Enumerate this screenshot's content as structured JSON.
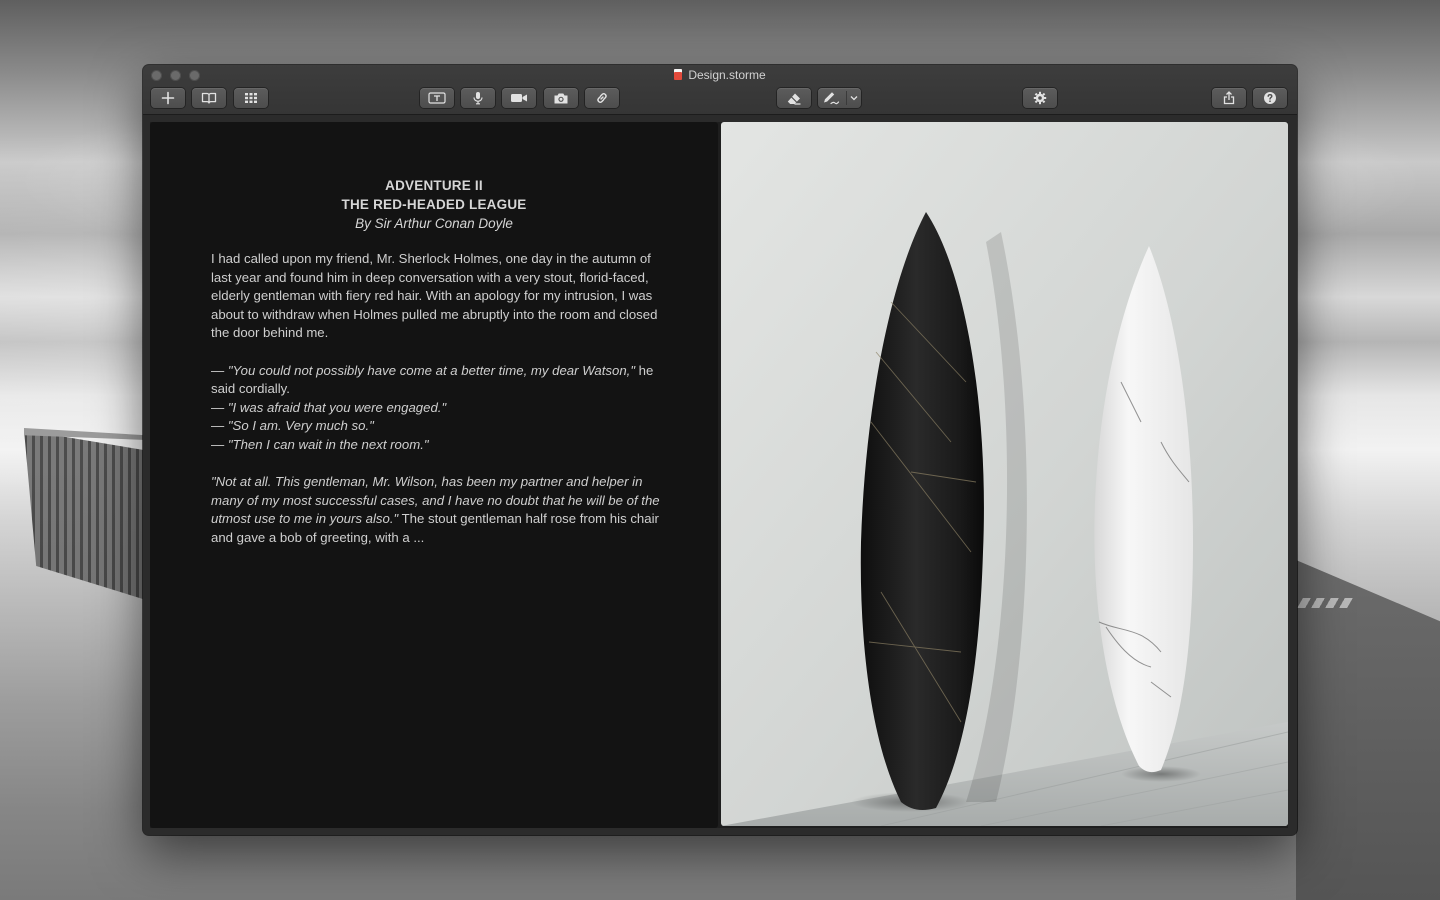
{
  "window": {
    "title": "Design.storme"
  },
  "toolbar": {
    "left": [
      {
        "name": "add-icon"
      },
      {
        "name": "book-icon"
      },
      {
        "name": "grid-icon"
      }
    ],
    "center": [
      {
        "name": "text-box-icon"
      },
      {
        "name": "microphone-icon"
      },
      {
        "name": "video-camera-icon"
      },
      {
        "name": "camera-icon"
      },
      {
        "name": "link-icon"
      }
    ],
    "tools": [
      {
        "name": "eraser-icon"
      },
      {
        "name": "pen-tool-icon"
      },
      {
        "name": "chevron-down-icon"
      }
    ],
    "settings": {
      "name": "gear-icon"
    },
    "right": [
      {
        "name": "share-icon"
      },
      {
        "name": "help-icon"
      }
    ]
  },
  "document": {
    "chapter": "ADVENTURE II",
    "story_title": "THE RED-HEADED LEAGUE",
    "byline": "By Sir Arthur Conan Doyle",
    "paragraph1": "I had called upon my friend, Mr. Sherlock Holmes, one day in the autumn of last year and found him in deep conversation with a very stout, florid-faced, elderly gentleman with fiery red hair. With an apology for my intrusion, I was about to withdraw when Holmes pulled me abruptly into the room and closed the door behind me.",
    "dialogue": [
      {
        "dash": "— ",
        "quote": "\"You could not possibly have come at a better time, my dear Watson,\"",
        "after": " he said cordially."
      },
      {
        "dash": "— ",
        "quote": "\"I was afraid that you were engaged.\"",
        "after": ""
      },
      {
        "dash": "— ",
        "quote": "\"So I am. Very much so.\"",
        "after": ""
      },
      {
        "dash": "— ",
        "quote": "\"Then I can wait in the next room.\"",
        "after": ""
      }
    ],
    "paragraph3_italic": "\"Not at all. This gentleman, Mr. Wilson, has been my partner and helper in many of my most successful cases, and I have no doubt that he will be of the utmost use to me in yours also.\"",
    "paragraph3_rest": " The stout gentleman half rose from his chair and gave a bob of greeting, with a ..."
  },
  "image": {
    "subject": "two surfboards leaning against a wall",
    "colors": {
      "wall": "#d4d6d4",
      "floor": "#b9bcbb",
      "board_dark": "#1c1c1c",
      "board_light": "#eeeeee"
    }
  }
}
